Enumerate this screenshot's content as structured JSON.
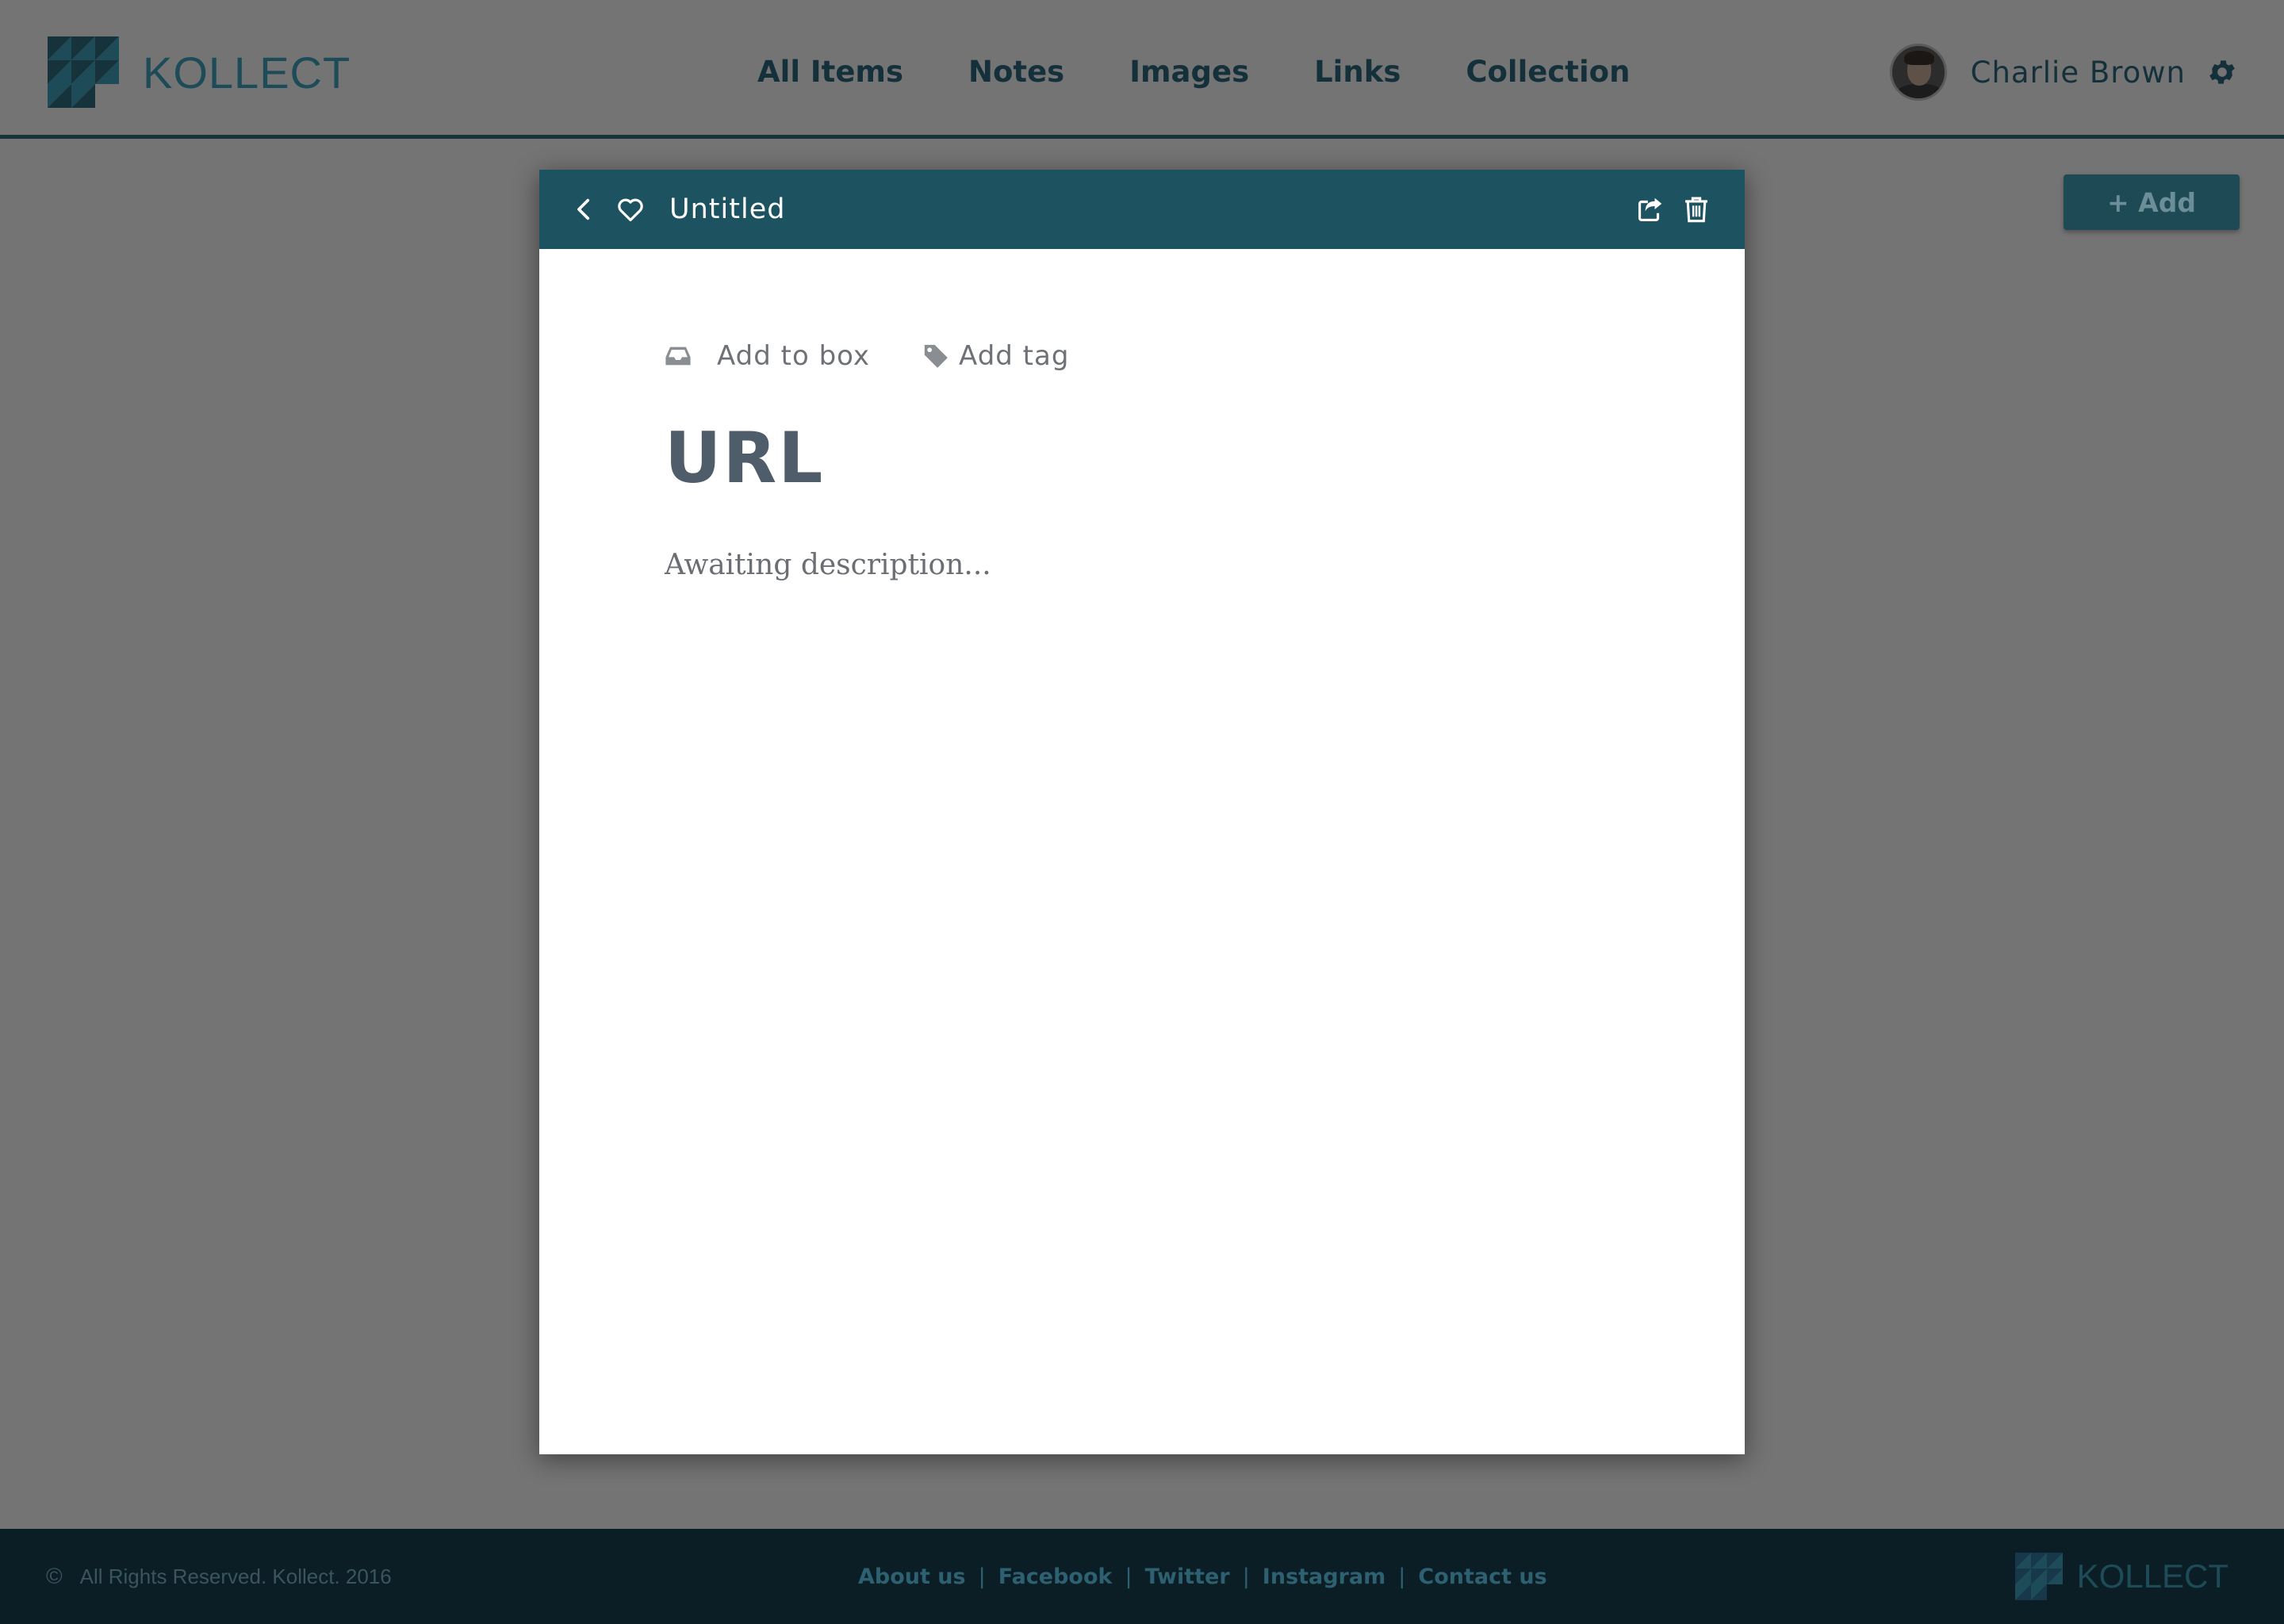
{
  "brand": {
    "name": "KOLLECT"
  },
  "nav": {
    "items": [
      {
        "label": "All Items"
      },
      {
        "label": "Notes"
      },
      {
        "label": "Images"
      },
      {
        "label": "Links"
      },
      {
        "label": "Collection"
      }
    ]
  },
  "user": {
    "name": "Charlie Brown",
    "avatar_icon": "avatar",
    "settings_icon": "gear-icon"
  },
  "toolbar": {
    "add_label": "+ Add"
  },
  "modal": {
    "title": "Untitled",
    "back_icon": "chevron-left-icon",
    "favorite_icon": "heart-icon",
    "share_icon": "share-icon",
    "delete_icon": "trash-icon",
    "add_to_box_label": "Add to box",
    "add_tag_label": "Add tag",
    "item_title": "URL",
    "description": "Awaiting description..."
  },
  "footer": {
    "copyright": "All Rights Reserved.  Kollect. 2016",
    "links": [
      {
        "label": "About us"
      },
      {
        "label": "Facebook"
      },
      {
        "label": "Twitter"
      },
      {
        "label": "Instagram"
      },
      {
        "label": "Contact us"
      }
    ],
    "brand": "KOLLECT"
  },
  "colors": {
    "header_teal": "#1d5260",
    "overlay_gray": "#747474",
    "footer_dark": "#0b1e25",
    "nav_text": "#14303a"
  }
}
